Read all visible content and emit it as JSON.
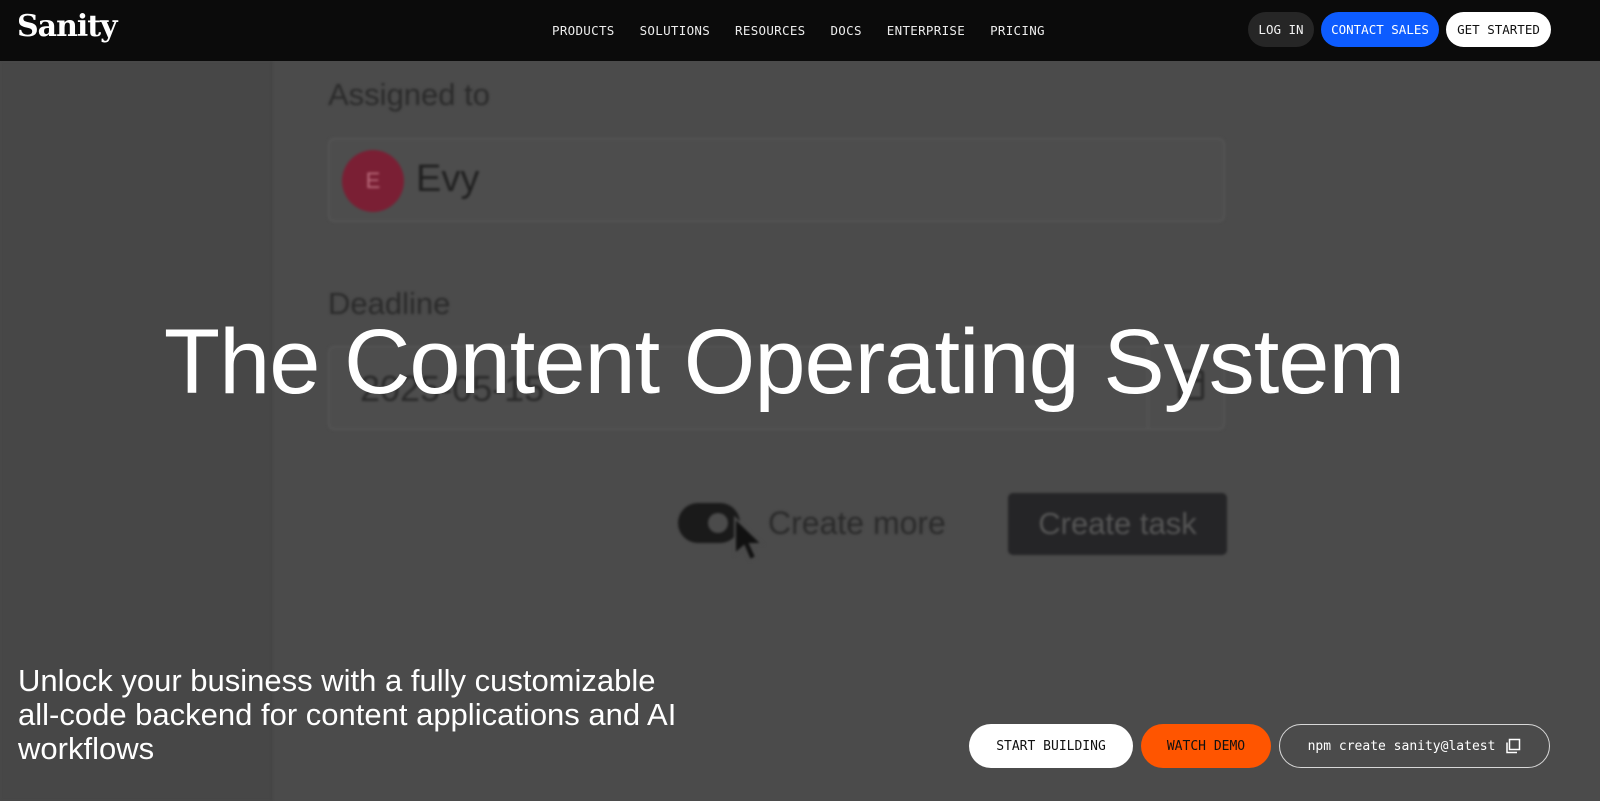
{
  "brand": {
    "logo_text": "Sanity"
  },
  "nav": {
    "items": [
      {
        "label": "PRODUCTS"
      },
      {
        "label": "SOLUTIONS"
      },
      {
        "label": "RESOURCES"
      },
      {
        "label": "DOCS"
      },
      {
        "label": "ENTERPRISE"
      },
      {
        "label": "PRICING"
      }
    ],
    "login_label": "LOG IN",
    "contact_label": "CONTACT SALES",
    "get_started_label": "GET STARTED"
  },
  "background_form": {
    "assigned_label": "Assigned to",
    "assignee_initial": "E",
    "assignee_name": "Evy",
    "deadline_label": "Deadline",
    "deadline_value": "2025-05-15",
    "create_more_label": "Create more",
    "create_task_label": "Create task"
  },
  "hero": {
    "headline": "The Content Operating System",
    "tagline": "Unlock your business with a fully customizable all-code backend for content applications and AI workflows"
  },
  "cta": {
    "start_label": "START BUILDING",
    "demo_label": "WATCH DEMO",
    "npm_command": "npm create sanity@latest"
  },
  "colors": {
    "nav_bg": "#0b0b0b",
    "contact_sales": "#0d5cff",
    "watch_demo": "#ff5500",
    "avatar": "#7a1f34"
  },
  "icons": [
    "cursor-icon",
    "calendar-icon",
    "copy-icon"
  ]
}
